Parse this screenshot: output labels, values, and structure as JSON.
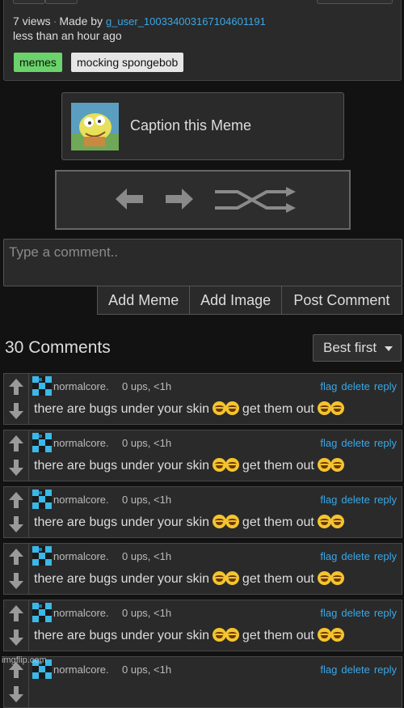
{
  "meme": {
    "views": "7 views",
    "made_by_label": "Made by",
    "username": "g_user_100334003167104601191",
    "time": "less than an hour ago",
    "tags": [
      "memes",
      "mocking spongebob"
    ]
  },
  "caption": {
    "label": "Caption this Meme"
  },
  "navigation": {
    "icons": [
      "arrow-left-icon",
      "arrow-right-icon",
      "shuffle-icon"
    ]
  },
  "comment_form": {
    "placeholder": "Type a comment..",
    "buttons": {
      "add_meme": "Add Meme",
      "add_image": "Add Image",
      "post_comment": "Post Comment"
    }
  },
  "comments_header": {
    "count_label": "30 Comments",
    "sort": "Best first"
  },
  "comments": [
    {
      "user": "normalcore.",
      "meta": "0 ups, <1h",
      "text_a": "there are bugs under your skin",
      "text_b": "get them out"
    },
    {
      "user": "normalcore.",
      "meta": "0 ups, <1h",
      "text_a": "there are bugs under your skin",
      "text_b": "get them out"
    },
    {
      "user": "normalcore.",
      "meta": "0 ups, <1h",
      "text_a": "there are bugs under your skin",
      "text_b": "get them out"
    },
    {
      "user": "normalcore.",
      "meta": "0 ups, <1h",
      "text_a": "there are bugs under your skin",
      "text_b": "get them out"
    },
    {
      "user": "normalcore.",
      "meta": "0 ups, <1h",
      "text_a": "there are bugs under your skin",
      "text_b": "get them out"
    },
    {
      "user": "normalcore.",
      "meta": "0 ups, <1h",
      "text_a": "",
      "text_b": ""
    }
  ],
  "comment_actions": {
    "flag": "flag",
    "delete": "delete",
    "reply": "reply"
  },
  "watermark": "imgflip.com",
  "colors": {
    "background": "#121212",
    "panel": "#2a2a2a",
    "link": "#3aa7e6",
    "tag_green": "#6bd36b"
  }
}
